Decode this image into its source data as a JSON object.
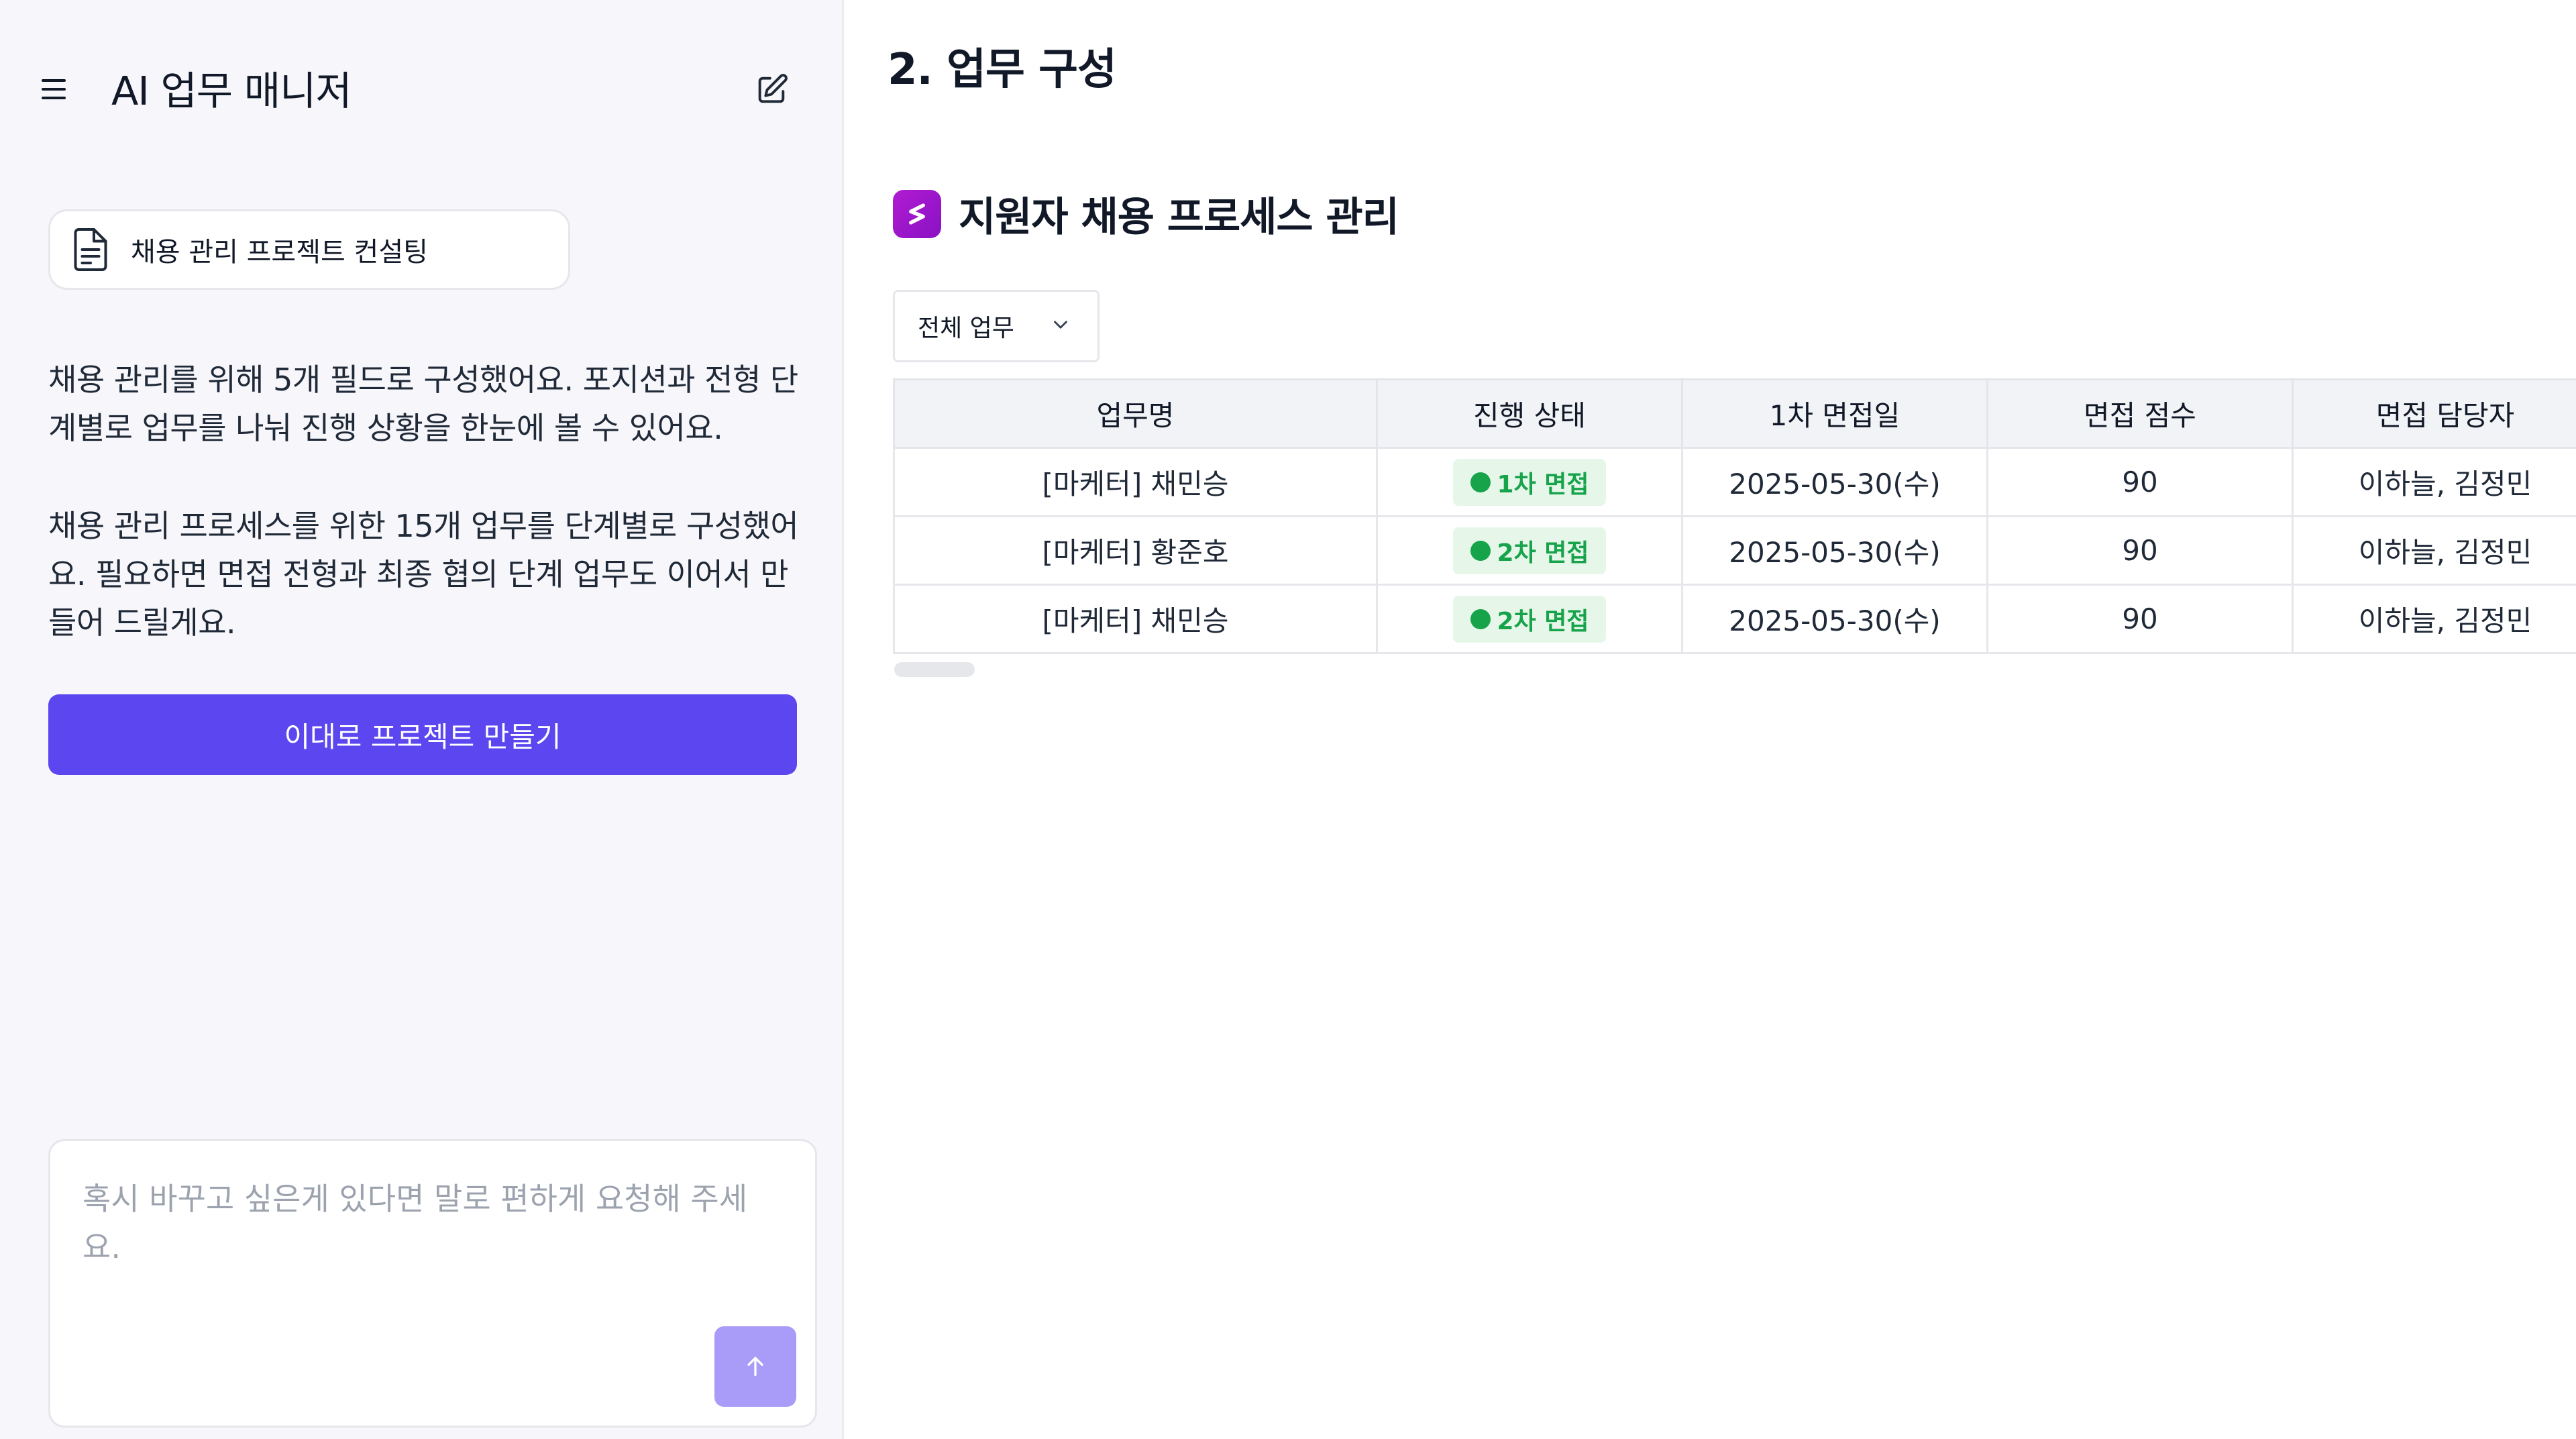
{
  "sidebar": {
    "app_title": "AI 업무 매니저",
    "project_chip": "채용 관리 프로젝트 컨설팅",
    "message_1": "채용 관리를 위해 5개 필드로 구성했어요. 포지션과 전형 단계별로 업무를 나눠 진행 상황을 한눈에 볼 수 있어요.",
    "message_2": "채용 관리 프로세스를 위한 15개 업무를 단계별로 구성했어요. 필요하면 면접 전형과 최종 협의 단계 업무도 이어서 만들어 드릴게요.",
    "create_button": "이대로 프로젝트 만들기",
    "input_placeholder": "혹시 바꾸고 싶은게 있다면 말로 편하게 요청해 주세요."
  },
  "main": {
    "section_title": "2. 업무 구성",
    "project_name": "지원자 채용 프로세스 관리",
    "filter_selected": "전체 업무",
    "table": {
      "headers": [
        "업무명",
        "진행 상태",
        "1차 면접일",
        "면접 점수",
        "면접 담당자"
      ],
      "rows": [
        {
          "name": "[마케터] 채민승",
          "status": "1차 면접",
          "date": "2025-05-30(수)",
          "score": "90",
          "owner": "이하늘, 김정민"
        },
        {
          "name": "[마케터] 황준호",
          "status": "2차 면접",
          "date": "2025-05-30(수)",
          "score": "90",
          "owner": "이하늘, 김정민"
        },
        {
          "name": "[마케터] 채민승",
          "status": "2차 면접",
          "date": "2025-05-30(수)",
          "score": "90",
          "owner": "이하늘, 김정민"
        }
      ]
    }
  },
  "colors": {
    "accent": "#5b46f0",
    "send_button": "#a89cf8",
    "brand_logo": "#a016cc",
    "status_green": "#16a34a",
    "status_badge_bg": "#e6f7ea"
  },
  "icons": [
    "menu-icon",
    "edit-icon",
    "document-icon",
    "brand-logo-icon",
    "chevron-down-icon",
    "arrow-up-icon",
    "status-dot-icon"
  ]
}
